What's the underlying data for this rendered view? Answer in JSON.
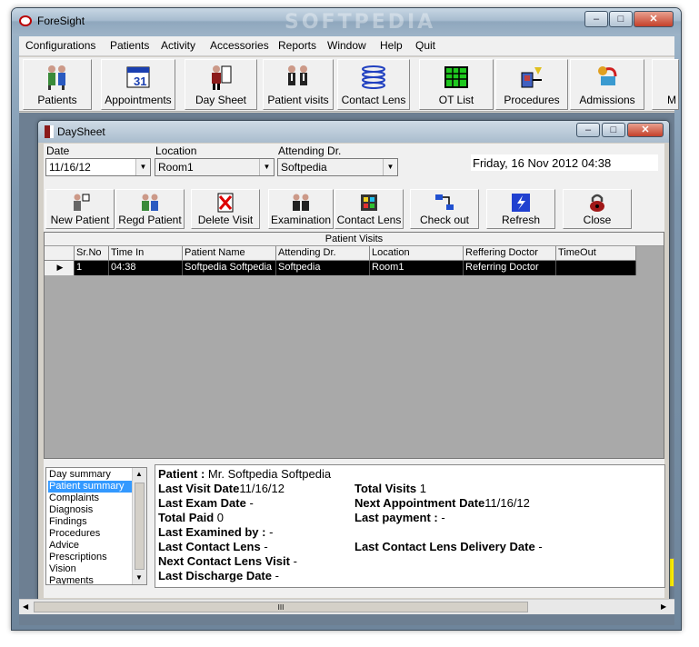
{
  "window": {
    "title": "ForeSight",
    "watermark": "SOFTPEDIA",
    "min": "–",
    "max": "□",
    "close": "✕"
  },
  "menu": [
    "Configurations",
    "Patients",
    "Activity",
    "Accessories",
    "Reports",
    "Window",
    "Help",
    "Quit"
  ],
  "toolbar": [
    {
      "label": "Patients",
      "icon": "patients-icon"
    },
    {
      "label": "Appointments",
      "icon": "calendar-icon"
    },
    {
      "label": "Day Sheet",
      "icon": "day-sheet-icon"
    },
    {
      "label": "Patient visits",
      "icon": "patient-visits-icon"
    },
    {
      "label": "Contact Lens",
      "icon": "contact-lens-icon"
    },
    {
      "label": "OT List",
      "icon": "ot-list-icon"
    },
    {
      "label": "Procedures",
      "icon": "procedures-icon"
    },
    {
      "label": "Admissions",
      "icon": "admissions-icon"
    },
    {
      "label": "M",
      "icon": "more-icon"
    }
  ],
  "daysheet": {
    "title": "DaySheet",
    "date_label": "Date",
    "date_value": "11/16/12",
    "location_label": "Location",
    "location_value": "Room1",
    "doctor_label": "Attending Dr.",
    "doctor_value": "Softpedia",
    "datetime": "Friday, 16 Nov 2012 04:38",
    "buttons": [
      "New Patient",
      "Regd Patient",
      "Delete Visit",
      "Examination",
      "Contact Lens",
      "Check out",
      "Refresh",
      "Close"
    ],
    "grid_caption": "Patient Visits",
    "columns": [
      "Sr.No",
      "Time In",
      "Patient Name",
      "Attending Dr.",
      "Location",
      "Reffering Doctor",
      "TimeOut"
    ],
    "rows": [
      [
        "1",
        "04:38",
        "Softpedia  Softpedia",
        "Softpedia",
        "Room1",
        "Referring Doctor",
        ""
      ]
    ],
    "summary_list": [
      "Day summary",
      "Patient summary",
      "Complaints",
      "Diagnosis",
      "Findings",
      "Procedures",
      "Advice",
      "Prescriptions",
      "Vision",
      "Payments"
    ],
    "summary_selected": 1,
    "summary": {
      "patient_label": "Patient :",
      "patient_value": "Mr. Softpedia      Softpedia",
      "last_visit_label": "Last Visit Date",
      "last_visit_value": "11/16/12",
      "total_visits_label": "Total Visits",
      "total_visits_value": "1",
      "last_exam_label": "Last Exam Date",
      "last_exam_value": "-",
      "next_appt_label": "Next Appointment Date",
      "next_appt_value": "11/16/12",
      "total_paid_label": "Total Paid",
      "total_paid_value": "0",
      "last_payment_label": "Last payment :",
      "last_payment_value": "-",
      "last_exam_by_label": "Last Examined by :",
      "last_exam_by_value": "-",
      "last_cl_label": "Last Contact Lens",
      "last_cl_value": "-",
      "last_cl_delivery_label": "Last Contact Lens Delivery Date",
      "last_cl_delivery_value": "-",
      "next_cl_visit_label": "Next Contact Lens Visit",
      "next_cl_visit_value": "-",
      "last_discharge_label": "Last Discharge Date",
      "last_discharge_value": "-"
    }
  },
  "scroll_grip": "III"
}
